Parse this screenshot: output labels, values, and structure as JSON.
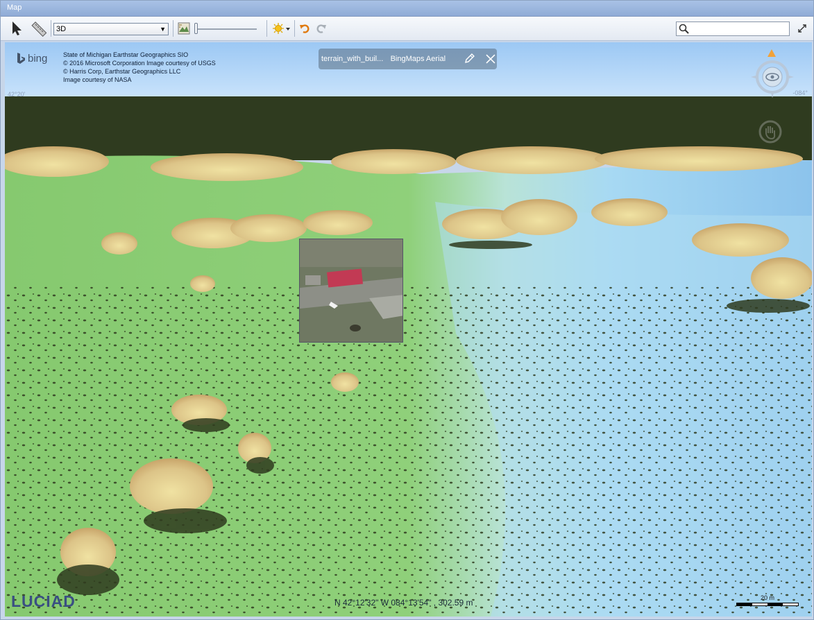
{
  "window": {
    "title": "Map"
  },
  "toolbar": {
    "mode_value": "3D",
    "tools": [
      "select-tool",
      "measure-tool",
      "terrain-tool",
      "lighting-tool",
      "undo",
      "redo",
      "fullscreen"
    ],
    "search": {
      "value": "",
      "placeholder": ""
    }
  },
  "map": {
    "bing_logo_text": "bing",
    "attribution": [
      "State of Michigan  Earthstar Geographics  SIO",
      "© 2016 Microsoft Corporation  Image courtesy of USGS",
      "© Harris Corp, Earthstar Geographics LLC",
      "Image courtesy of NASA"
    ],
    "lat_label_left": "42°20'",
    "lon_label_right": "-084°",
    "layer_bar": {
      "name": "terrain_with_buil...",
      "sub": "BingMaps Aerial"
    },
    "coordinates": "N 42°12'32\"  W 084°13'54\" , 302.59 m",
    "scale_label": "20 m",
    "brand": "LUCIAD",
    "colors": {
      "sky": "#a8d0f8",
      "horizon": "#2f3b1f",
      "grass": "#8fd07a",
      "water": "#a9dcf4",
      "trees": "#e6d08a"
    }
  }
}
